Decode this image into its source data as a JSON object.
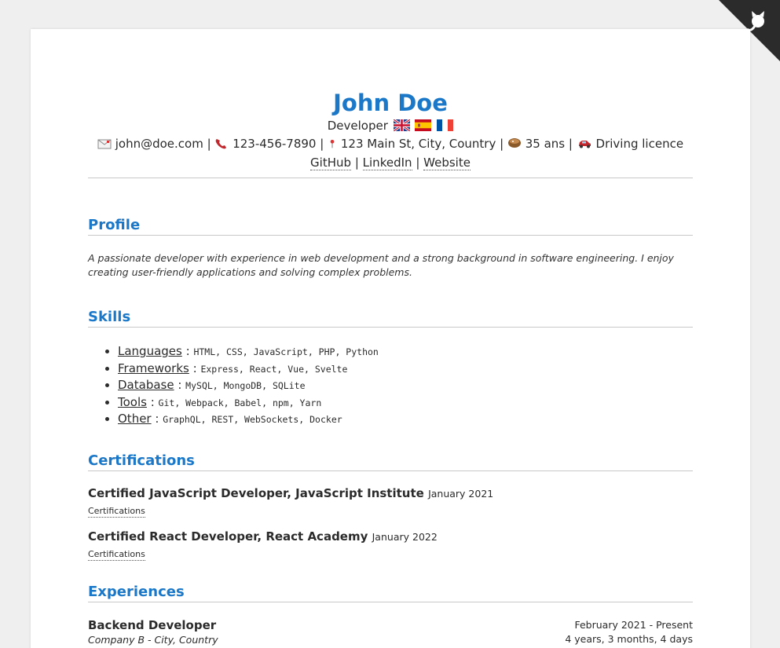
{
  "header": {
    "name": "John Doe",
    "role": "Developer",
    "flags": [
      "uk-flag-icon",
      "spain-flag-icon",
      "france-flag-icon"
    ],
    "email": "john@doe.com",
    "phone": "123-456-7890",
    "address": "123 Main St, City, Country",
    "age": "35 ans",
    "licence": "Driving licence",
    "separator": "|",
    "links": [
      "GitHub",
      "LinkedIn",
      "Website"
    ]
  },
  "sections": {
    "profile": {
      "title": "Profile",
      "text": "A passionate developer with experience in web development and a strong background in software engineering. I enjoy creating user-friendly applications and solving complex problems."
    },
    "skills": {
      "title": "Skills",
      "items": [
        {
          "name": "Languages",
          "values": "HTML, CSS, JavaScript, PHP, Python"
        },
        {
          "name": "Frameworks",
          "values": "Express, React, Vue, Svelte"
        },
        {
          "name": "Database",
          "values": "MySQL, MongoDB, SQLite"
        },
        {
          "name": "Tools",
          "values": "Git, Webpack, Babel, npm, Yarn"
        },
        {
          "name": "Other",
          "values": "GraphQL, REST, WebSockets, Docker"
        }
      ]
    },
    "certifications": {
      "title": "Certifications",
      "items": [
        {
          "title": "Certified JavaScript Developer, JavaScript Institute",
          "date": "January 2021",
          "tag": "Certifications"
        },
        {
          "title": "Certified React Developer, React Academy",
          "date": "January 2022",
          "tag": "Certifications"
        }
      ]
    },
    "experiences": {
      "title": "Experiences",
      "items": [
        {
          "title": "Backend Developer",
          "company": "Company B - City, Country",
          "period": "February 2021 - Present",
          "duration": "4 years, 3 months, 4 days"
        }
      ]
    }
  },
  "colors": {
    "accent": "#1b78c8",
    "page": "#ffffff",
    "background": "#efefef",
    "corner": "#2b2b2b"
  }
}
